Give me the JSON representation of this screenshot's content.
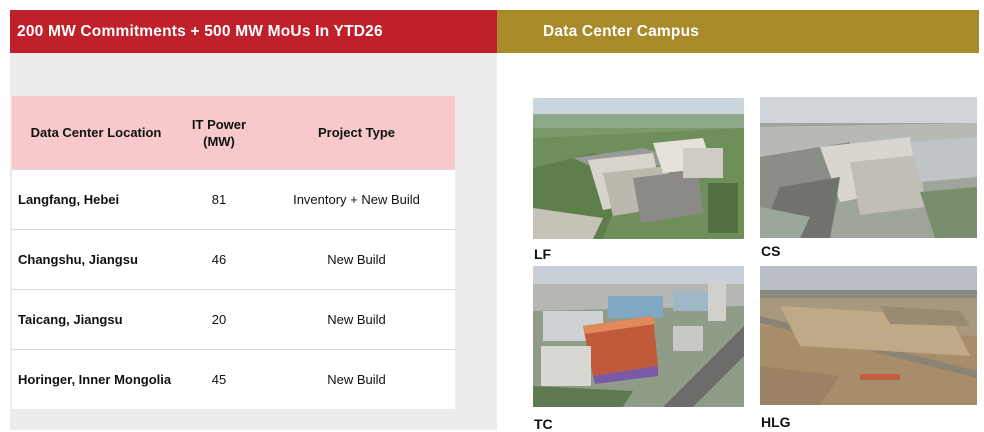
{
  "left_header": "200 MW Commitments + 500 MW MoUs In YTD26",
  "right_header": "Data Center Campus",
  "table": {
    "headers": {
      "location": "Data Center Location",
      "power_line1": "IT Power",
      "power_line2": "(MW)",
      "type": "Project Type"
    },
    "rows": [
      {
        "location": "Langfang, Hebei",
        "power": "81",
        "type": "Inventory + New Build"
      },
      {
        "location": "Changshu, Jiangsu",
        "power": "46",
        "type": "New Build"
      },
      {
        "location": "Taicang, Jiangsu",
        "power": "20",
        "type": "New Build"
      },
      {
        "location": "Horinger, Inner Mongolia",
        "power": "45",
        "type": "New Build"
      }
    ]
  },
  "photos": [
    {
      "caption": "LF"
    },
    {
      "caption": "CS"
    },
    {
      "caption": "TC"
    },
    {
      "caption": "HLG"
    }
  ],
  "colors": {
    "left_header_bg": "#c0202a",
    "right_header_bg": "#a88a2a",
    "table_header_bg": "#f7c9cc"
  }
}
